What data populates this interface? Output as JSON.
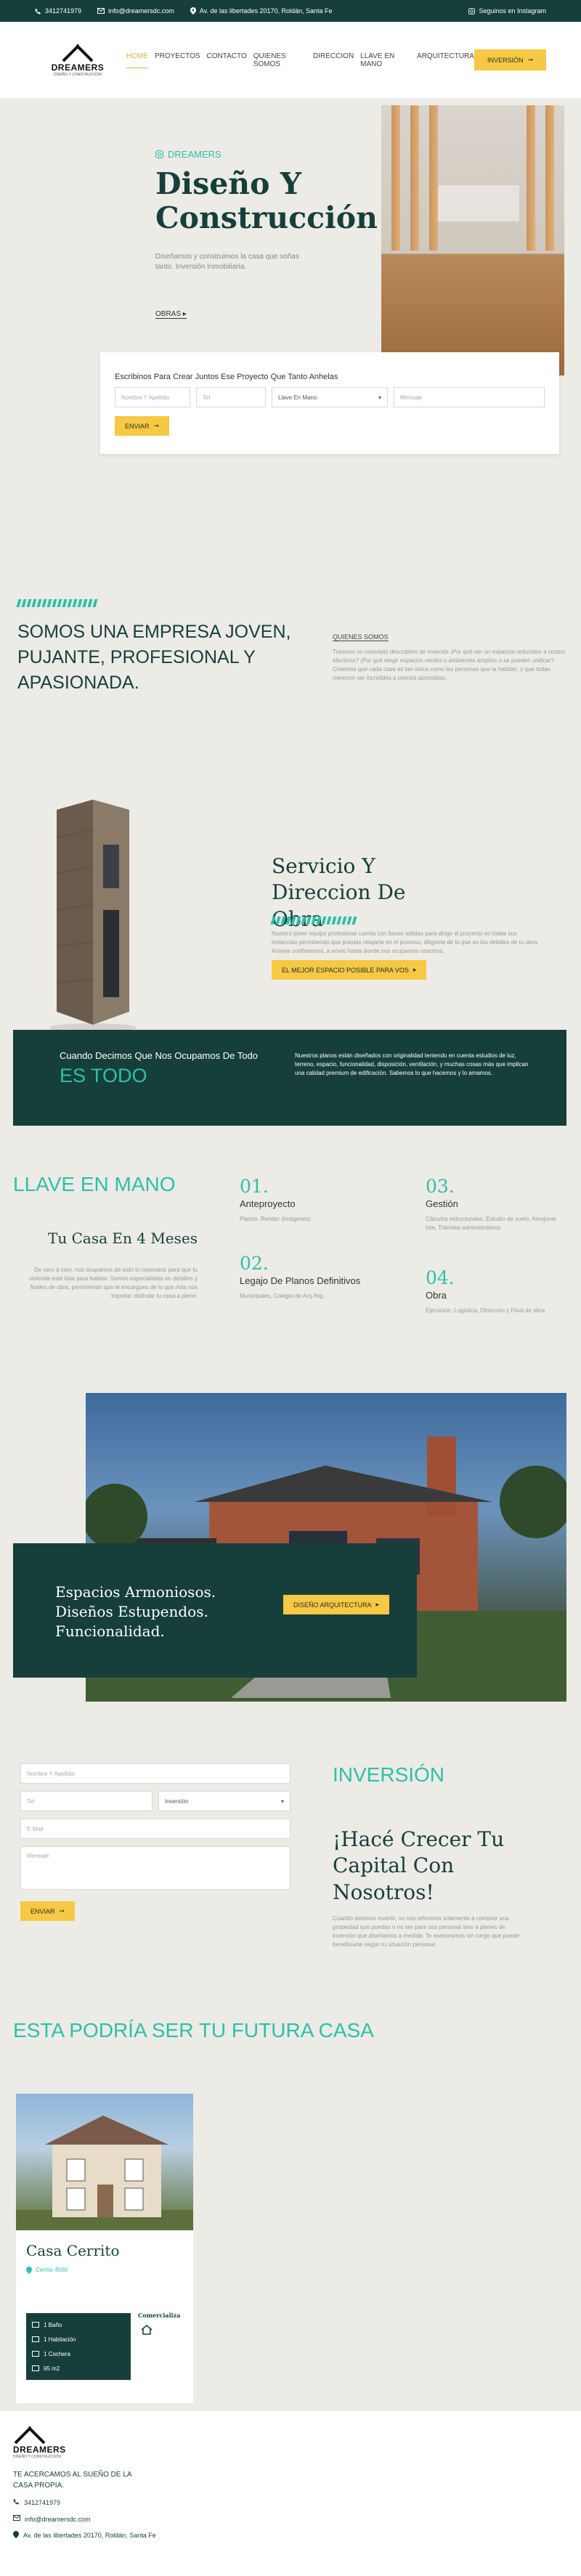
{
  "topbar": {
    "phone": "3412741979",
    "email": "info@dreamersdc.com",
    "address": "Av. de las libertades 20170, Roldán, Santa Fe",
    "instagram": "Seguinos en Instagram"
  },
  "header": {
    "logo": "DREAMERS",
    "logo_sub": "DISEÑO Y CONSTRUCCIÓN",
    "nav": [
      "Home",
      "Proyectos",
      "Contacto",
      "Quienes Somos",
      "Direccion",
      "Llave En Mano",
      "Arquitectura"
    ],
    "cta": "Inversión"
  },
  "hero": {
    "brand": "DREAMERS",
    "title": "Diseño Y Construcción",
    "desc": "Diseñamos y construimos la casa que soñas tanto. Inversión Inmobiliaria.",
    "link": "OBRAS",
    "form_title": "Escribinos Para Crear Juntos Ese Proyecto Que Tanto Anhelas",
    "name_ph": "Nombre Y Apellido",
    "phone_ph": "Tel",
    "select_value": "Llave En Mano",
    "message_ph": "Mensaje",
    "submit": "Enviar"
  },
  "about": {
    "title": "SOMOS UNA EMPRESA JOVEN, PUJANTE, PROFESIONAL Y APASIONADA.",
    "tag": "Quienes Somos",
    "text": "Trasmos un concepto descriptivo de vivienda ¡Por qué ser un espacios reducidos a costos efectivos? ¡Por qué elegir espacios verdes o ambientes amplios o se pueden unificar? Creemos que cada casa es tan única como las personas que la habitan, y que todas merecen ser increíbles a precios accesibles."
  },
  "service": {
    "title": "Servicio Y Direccion De Obra",
    "text": "Nuestro joven equipo profesional cuenta con bases sólidas para dirigir el proyecto en todas sus instancias permitiendo que puedas relajarte en el proceso, diligente de lo que es los detalles de tu obra. Aviseje confiaremos, a envío hasta donde nos ocupamos nosotros.",
    "cta": "El mejor espacio posible para vos"
  },
  "todo": {
    "small": "Cuando Decimos Que Nos Ocupamos De Todo",
    "big": "ES TODO",
    "text": "Nuestros planos están diseñados con originalidad teniendo en cuenta estudios de luz, terreno, espacio, funcionalidad, disposición, ventilación, y muchas cosas más que implican una calidad premium de edificación. Sabemos lo que hacemos y lo amamos."
  },
  "llave": {
    "title": "LLAVE EN MANO",
    "subtitle": "Tu Casa En 4 Meses",
    "desc": "De cero a cien, nos ocupamos de todo lo necesario para que tu vivienda esté lista para habitar. Somos especialistas en detalles y finales de obra, permitiendo que te encargues de lo que más nos importa: disfrutar tu casa a pleno.",
    "steps": [
      {
        "num": "01.",
        "name": "Anteproyecto",
        "desc": "Planos. Render (Imágenes)"
      },
      {
        "num": "02.",
        "name": "Legajo De Planos Definitivos",
        "desc": "Municipales, Colegio de Arq./Ing."
      },
      {
        "num": "03.",
        "name": "Gestión",
        "desc": "Cálculos estructurales, Estudio de suelo, Amojonar lote, Trámites administrativos"
      },
      {
        "num": "04.",
        "name": "Obra",
        "desc": "Ejecución, Logística, Dirección y Final de obra"
      }
    ]
  },
  "house": {
    "card_text": "Espacios Armoniosos. Diseños Estupendos. Funcionalidad.",
    "cta": "Diseño Arquitectura"
  },
  "invest": {
    "name_ph": "Nombre Y Apellido",
    "phone_ph": "Tel",
    "select_value": "Inversión",
    "email_ph": "E-Mail",
    "message_ph": "Mensaje",
    "submit": "Enviar",
    "title": "INVERSIÓN",
    "heading": "¡Hacé Crecer Tu Capital Con Nosotros!",
    "text": "Cuando decimos invertir, no nos referimos solamente a comprar una propiedad que puedas o no ser para uso personal sino a planes de inversión que diseñamos a medida. Te asesoramos sin cargo que puede beneficiarte según tu situación personal."
  },
  "future": {
    "title": "ESTA PODRÍA SER TU FUTURA CASA",
    "property": {
      "name": "Casa Cerrito",
      "location": "Cerrito 4500",
      "features": [
        "1 Baño",
        "1 Habitación",
        "1 Cochera",
        "95 m2"
      ],
      "status": "Comercializa"
    }
  },
  "footer": {
    "slogan": "TE ACERCAMOS AL SUEÑO DE LA CASA PROPIA.",
    "phone": "3412741979",
    "email": "info@dreamersdc.com",
    "address": "Av. de las libertades 20170, Roldán, Santa Fe"
  },
  "colors": {
    "dark_green": "#163f3c",
    "teal": "#2fc0a8",
    "yellow": "#f7c843",
    "background": "#ecebe6"
  }
}
